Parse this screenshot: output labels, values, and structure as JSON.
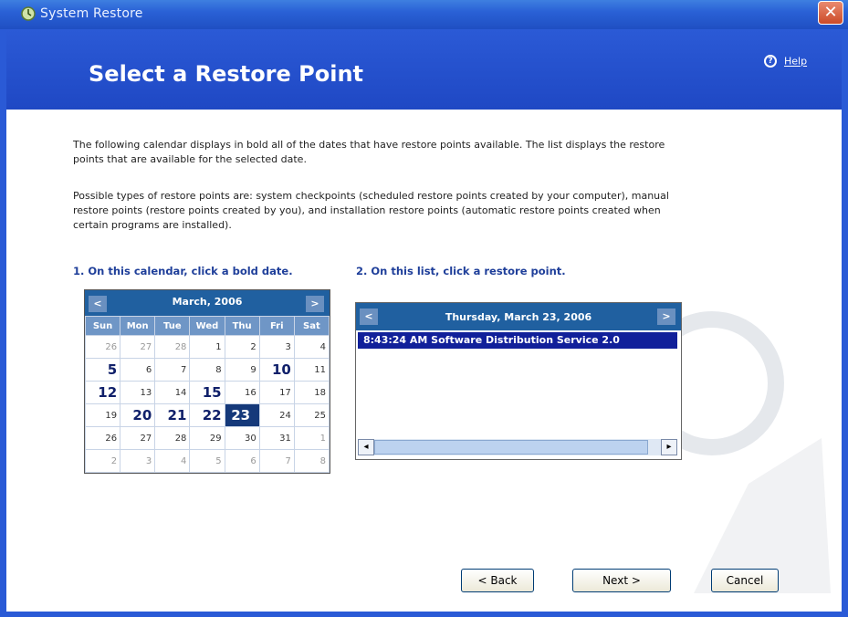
{
  "window": {
    "title": "System Restore",
    "close_glyph": "✕"
  },
  "header": {
    "title": "Select a Restore Point",
    "help_label": "Help",
    "help_glyph": "?"
  },
  "intro": {
    "p1": "The following calendar displays in bold all of the dates that have restore points available. The list displays the restore points that are available for the selected date.",
    "p2": "Possible types of restore points are: system checkpoints (scheduled restore points created by your computer), manual restore points (restore points created by you), and installation restore points (automatic restore points created when certain programs are installed)."
  },
  "steps": {
    "step1": "1. On this calendar, click a bold date.",
    "step2": "2. On this list, click a restore point."
  },
  "calendar": {
    "month_label": "March, 2006",
    "prev_glyph": "<",
    "next_glyph": ">",
    "weekdays": [
      "Sun",
      "Mon",
      "Tue",
      "Wed",
      "Thu",
      "Fri",
      "Sat"
    ],
    "weeks": [
      [
        {
          "d": "26",
          "s": "dim"
        },
        {
          "d": "27",
          "s": "dim"
        },
        {
          "d": "28",
          "s": "dim"
        },
        {
          "d": "1",
          "s": ""
        },
        {
          "d": "2",
          "s": ""
        },
        {
          "d": "3",
          "s": ""
        },
        {
          "d": "4",
          "s": ""
        }
      ],
      [
        {
          "d": "5",
          "s": "bold"
        },
        {
          "d": "6",
          "s": ""
        },
        {
          "d": "7",
          "s": ""
        },
        {
          "d": "8",
          "s": ""
        },
        {
          "d": "9",
          "s": ""
        },
        {
          "d": "10",
          "s": "bold"
        },
        {
          "d": "11",
          "s": ""
        }
      ],
      [
        {
          "d": "12",
          "s": "bold"
        },
        {
          "d": "13",
          "s": ""
        },
        {
          "d": "14",
          "s": ""
        },
        {
          "d": "15",
          "s": "bold"
        },
        {
          "d": "16",
          "s": ""
        },
        {
          "d": "17",
          "s": ""
        },
        {
          "d": "18",
          "s": ""
        }
      ],
      [
        {
          "d": "19",
          "s": ""
        },
        {
          "d": "20",
          "s": "bold"
        },
        {
          "d": "21",
          "s": "bold"
        },
        {
          "d": "22",
          "s": "bold"
        },
        {
          "d": "23",
          "s": "sel"
        },
        {
          "d": "24",
          "s": ""
        },
        {
          "d": "25",
          "s": ""
        }
      ],
      [
        {
          "d": "26",
          "s": ""
        },
        {
          "d": "27",
          "s": ""
        },
        {
          "d": "28",
          "s": ""
        },
        {
          "d": "29",
          "s": ""
        },
        {
          "d": "30",
          "s": ""
        },
        {
          "d": "31",
          "s": ""
        },
        {
          "d": "1",
          "s": "dim"
        }
      ],
      [
        {
          "d": "2",
          "s": "dim"
        },
        {
          "d": "3",
          "s": "dim"
        },
        {
          "d": "4",
          "s": "dim"
        },
        {
          "d": "5",
          "s": "dim"
        },
        {
          "d": "6",
          "s": "dim"
        },
        {
          "d": "7",
          "s": "dim"
        },
        {
          "d": "8",
          "s": "dim"
        }
      ]
    ]
  },
  "restore_list": {
    "date_label": "Thursday, March 23, 2006",
    "prev_glyph": "<",
    "next_glyph": ">",
    "items": [
      {
        "label": "8:43:24 AM  Software Distribution Service 2.0"
      }
    ],
    "scroll_left_glyph": "◂",
    "scroll_right_glyph": "▸"
  },
  "buttons": {
    "back": "< Back",
    "next": "Next >",
    "cancel": "Cancel"
  },
  "colors": {
    "title_blue": "#2a5ad6",
    "calendar_header": "#2060a0",
    "selection": "#11209a"
  }
}
